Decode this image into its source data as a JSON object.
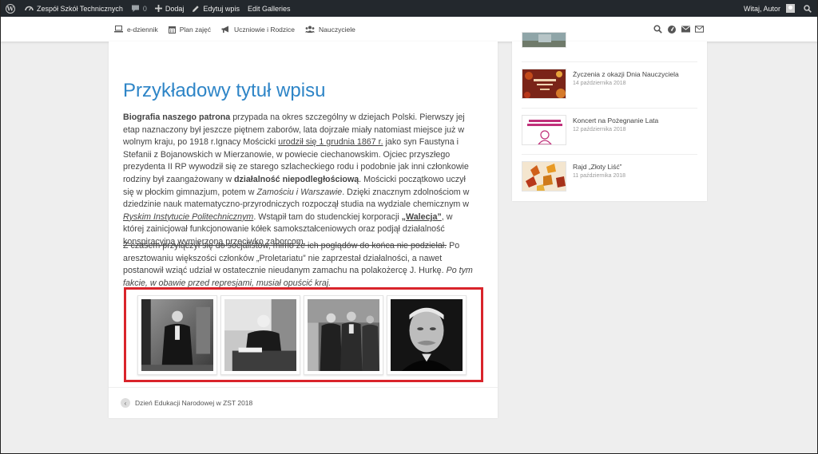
{
  "admin_bar": {
    "site_name": "Zespół Szkół Technicznych",
    "comments_count": "0",
    "add_label": "Dodaj",
    "edit_label": "Edytuj wpis",
    "galleries_label": "Edit Galleries",
    "greeting": "Witaj, Autor"
  },
  "nav": {
    "items": [
      {
        "label": "e-dziennik"
      },
      {
        "label": "Plan zajęć"
      },
      {
        "label": "Uczniowie i Rodzice"
      },
      {
        "label": "Nauczyciele"
      }
    ]
  },
  "post": {
    "title": "Przykładowy tytuł wpisu",
    "p1": {
      "bold1": "Biografia naszego patrona",
      "t1": " przypada na okres szczególny w dziejach Polski. Pierwszy jej etap naznaczony był jeszcze piętnem zaborów, lata dojrzałe miały natomiast miejsce już w wolnym kraju, po 1918 r.Ignacy Mościcki ",
      "u1": "urodził się 1 grudnia 1867 r.",
      "t2": " jako syn Faustyna i Stefanii z Bojanowskich w Mierzanowie, w powiecie ciechanowskim. Ojciec przyszłego prezydenta II RP wywodził się ze starego szlacheckiego rodu i podobnie jak inni członkowie rodziny był zaangażowany w ",
      "bold2": "działalność niepodległościową",
      "t3": ". Mościcki początkowo uczył się w płockim gimnazjum, potem w ",
      "i1": "Zamościu i Warszawie",
      "t4": ". Dzięki znacznym zdolnościom w dziedzinie nauk matematyczno-przyrodniczych rozpoczął studia na wydziale chemicznym w ",
      "i2": "Ryskim Instytucie Politechnicznym",
      "t5": ". Wstąpił tam do studenckiej korporacji ",
      "bold3": "„Walecja”",
      "t6": ", w której zainicjował funkcjonowanie kółek samokształceniowych oraz podjął działalność konspiracyjną wymierzoną przeciwko zaborcom."
    },
    "p2": {
      "strike": "Z czasem przyłączył się do socjalistów, mimo że ich poglądów do końca nie podzielał.",
      "t1": " Po aresztowaniu większości członków „Proletariatu” nie zaprzestał działalności, a nawet postanowił wziąć udział w ostatecznie nieudanym zamachu na polakożercę J. Hurkę.",
      "i1": " Po tym fakcie, w obawie przed represjami, musiał opuścić kraj."
    },
    "gallery_count": 4,
    "prev_post": "Dzień Edukacji Narodowej w ZST 2018"
  },
  "sidebar": {
    "items": [
      {
        "title": "",
        "date": ""
      },
      {
        "title": "Życzenia z okazji Dnia Nauczyciela",
        "date": "14 października 2018"
      },
      {
        "title": "Koncert na Pożegnanie Lata",
        "date": "12 października 2018"
      },
      {
        "title": "Rajd „Złoty Liść”",
        "date": "11 października 2018"
      }
    ],
    "thumb2_text": "SAMORZĄD UCZNIOWSKI"
  },
  "colors": {
    "accent": "#2e85c7",
    "admin_bar": "#23282d",
    "gallery_highlight": "#d9242b"
  }
}
